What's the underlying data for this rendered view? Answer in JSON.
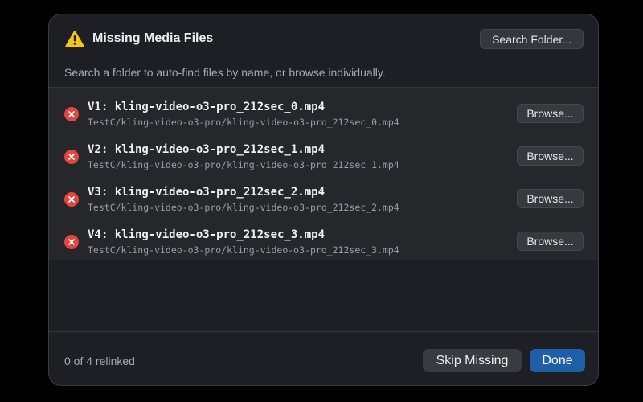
{
  "dialog": {
    "title": "Missing Media Files",
    "search_folder_label": "Search Folder...",
    "subtitle": "Search a folder to auto-find files by name, or browse individually.",
    "status_text": "0 of 4 relinked",
    "skip_label": "Skip Missing",
    "done_label": "Done",
    "icons": {
      "header": "warning-icon",
      "row_status": "error-icon"
    },
    "colors": {
      "warning": "#f5c518",
      "error": "#e5453e",
      "primary": "#1e5fa8"
    }
  },
  "files": [
    {
      "name": "V1: kling-video-o3-pro_212sec_0.mp4",
      "path": "TestC/kling-video-o3-pro/kling-video-o3-pro_212sec_0.mp4",
      "browse_label": "Browse..."
    },
    {
      "name": "V2: kling-video-o3-pro_212sec_1.mp4",
      "path": "TestC/kling-video-o3-pro/kling-video-o3-pro_212sec_1.mp4",
      "browse_label": "Browse..."
    },
    {
      "name": "V3: kling-video-o3-pro_212sec_2.mp4",
      "path": "TestC/kling-video-o3-pro/kling-video-o3-pro_212sec_2.mp4",
      "browse_label": "Browse..."
    },
    {
      "name": "V4: kling-video-o3-pro_212sec_3.mp4",
      "path": "TestC/kling-video-o3-pro/kling-video-o3-pro_212sec_3.mp4",
      "browse_label": "Browse..."
    }
  ]
}
